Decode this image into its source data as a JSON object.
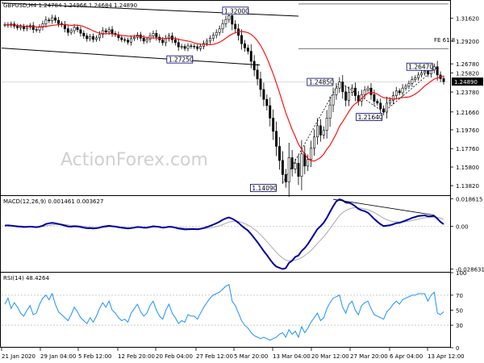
{
  "chart_data": [
    {
      "type": "candlestick",
      "header": "GBPUSD,H4  1.24784 1.24966 1.24684 1.24890",
      "price_axis_ticks": [
        "1.31620",
        "1.29200",
        "1.26780",
        "1.25820",
        "1.23780",
        "1.21660",
        "1.19760",
        "1.17760",
        "1.15800",
        "1.13820"
      ],
      "price_axis_values": [
        1.3162,
        1.292,
        1.2678,
        1.2582,
        1.2378,
        1.2166,
        1.1976,
        1.1776,
        1.158,
        1.1382
      ],
      "current_price_label": "1.24890",
      "ylim": [
        1.128,
        1.334
      ],
      "fib_label": "FE 61.8",
      "annotations": [
        {
          "label": "1.32000",
          "price": 1.32,
          "date": "5 Mar"
        },
        {
          "label": "1.27250",
          "price": 1.2725,
          "date": "27 Feb"
        },
        {
          "label": "1.24850",
          "price": 1.2485,
          "date": "26 Mar"
        },
        {
          "label": "1.26470",
          "price": 1.2647,
          "date": "13 Apr"
        },
        {
          "label": "1.21640",
          "price": 1.2164,
          "date": "6 Apr"
        },
        {
          "label": "1.14090",
          "price": 1.1409,
          "date": "20 Mar"
        }
      ],
      "close": [
        1.3095,
        1.3088,
        1.3102,
        1.3079,
        1.3061,
        1.3075,
        1.3052,
        1.3068,
        1.3085,
        1.3043,
        1.3038,
        1.3068,
        1.3102,
        1.3145,
        1.3136,
        1.3168,
        1.3142,
        1.3105,
        1.3095,
        1.3052,
        1.3012,
        1.3031,
        1.3066,
        1.3041,
        1.3004,
        1.2975,
        1.2945,
        1.2968,
        1.2938,
        1.2955,
        1.299,
        1.3031,
        1.3016,
        1.3042,
        1.3002,
        1.2988,
        1.2955,
        1.2935,
        1.293,
        1.2908,
        1.2946,
        1.296,
        1.2985,
        1.2951,
        1.292,
        1.294,
        1.2975,
        1.3002,
        1.2962,
        1.2932,
        1.2903,
        1.2946,
        1.2975,
        1.2935,
        1.2905,
        1.2858,
        1.2863,
        1.2842,
        1.2869,
        1.2865,
        1.286,
        1.284,
        1.2865,
        1.2895,
        1.292,
        1.295,
        1.2981,
        1.3012,
        1.305,
        1.3105,
        1.315,
        1.319,
        1.31,
        1.305,
        1.298,
        1.2892,
        1.2847,
        1.2812,
        1.2705,
        1.2612,
        1.2517,
        1.2405,
        1.23,
        1.2233,
        1.21,
        1.196,
        1.18,
        1.165,
        1.15,
        1.142,
        1.168,
        1.156,
        1.162,
        1.148,
        1.172,
        1.159,
        1.166,
        1.178,
        1.19,
        1.202,
        1.192,
        1.197,
        1.21,
        1.224,
        1.235,
        1.242,
        1.2485,
        1.238,
        1.229,
        1.2375,
        1.242,
        1.234,
        1.228,
        1.235,
        1.24,
        1.242,
        1.235,
        1.228,
        1.226,
        1.22,
        1.2164,
        1.226,
        1.229,
        1.234,
        1.239,
        1.237,
        1.242,
        1.244,
        1.247,
        1.251,
        1.253,
        1.256,
        1.258,
        1.26,
        1.257,
        1.2612,
        1.2647,
        1.256,
        1.252,
        1.2489
      ],
      "series": [
        {
          "name": "",
          "note": "moving average, red"
        }
      ]
    },
    {
      "type": "line",
      "header": "MACD(12,26,9) 0.001461 0.003627",
      "axis_ticks": [
        "0.018615",
        "0.00",
        "-0.028631"
      ],
      "axis_values": [
        0.018615,
        0.0,
        -0.028631
      ],
      "ylim": [
        -0.0305,
        0.0204
      ],
      "series": [
        {
          "name": "",
          "values": [
            0.0006,
            0.0007,
            0.0005,
            0.0002,
            0.0,
            -0.0002,
            -0.0004,
            -0.0003,
            -0.0001,
            -0.0003,
            -0.0005,
            -0.0002,
            0.0005,
            0.0016,
            0.0021,
            0.0024,
            0.0021,
            0.0016,
            0.0012,
            0.0006,
            0.0,
            -0.0002,
            0.0001,
            0.0,
            -0.0004,
            -0.0008,
            -0.0012,
            -0.0012,
            -0.0014,
            -0.0012,
            -0.0008,
            -0.0002,
            0.0001,
            0.0004,
            0.0001,
            -0.0001,
            -0.0005,
            -0.0009,
            -0.0011,
            -0.0014,
            -0.0011,
            -0.0008,
            -0.0004,
            -0.0005,
            -0.0008,
            -0.0008,
            -0.0004,
            0.0001,
            -0.0001,
            -0.0004,
            -0.0008,
            -0.0006,
            -0.0002,
            -0.0004,
            -0.0008,
            -0.0014,
            -0.0017,
            -0.002,
            -0.0019,
            -0.0018,
            -0.0018,
            -0.0019,
            -0.0016,
            -0.0011,
            -0.0004,
            0.0003,
            0.0012,
            0.0021,
            0.0031,
            0.0044,
            0.0054,
            0.006,
            0.0052,
            0.004,
            0.0024,
            0.0005,
            -0.0012,
            -0.0028,
            -0.0052,
            -0.0078,
            -0.0105,
            -0.0135,
            -0.0165,
            -0.0192,
            -0.0222,
            -0.025,
            -0.027,
            -0.0278,
            -0.0286,
            -0.028,
            -0.0245,
            -0.023,
            -0.0205,
            -0.0195,
            -0.0165,
            -0.0145,
            -0.0118,
            -0.0085,
            -0.0052,
            -0.0018,
            0.0002,
            0.0025,
            0.0058,
            0.0098,
            0.0135,
            0.0168,
            0.0182,
            0.0175,
            0.016,
            0.0158,
            0.015,
            0.0135,
            0.0118,
            0.0108,
            0.0102,
            0.0092,
            0.0072,
            0.005,
            0.0032,
            0.0015,
            0.0002,
            0.0005,
            0.0008,
            0.0014,
            0.0022,
            0.0024,
            0.0032,
            0.004,
            0.0048,
            0.0057,
            0.0063,
            0.007,
            0.0072,
            0.0074,
            0.0068,
            0.0068,
            0.007,
            0.0052,
            0.003,
            0.0015
          ]
        },
        {
          "name": "",
          "values": [
            0.0006,
            0.0006,
            0.0006,
            0.0005,
            0.0004,
            0.0003,
            0.0001,
            0.0,
            0.0,
            -0.0001,
            -0.0002,
            -0.0002,
            -0.0001,
            0.0003,
            0.0007,
            0.001,
            0.0012,
            0.0013,
            0.0013,
            0.0012,
            0.001,
            0.0007,
            0.0006,
            0.0005,
            0.0003,
            0.0001,
            -0.0002,
            -0.0004,
            -0.0006,
            -0.0007,
            -0.0008,
            -0.0007,
            -0.0005,
            -0.0003,
            -0.0002,
            -0.0002,
            -0.0003,
            -0.0004,
            -0.0006,
            -0.0007,
            -0.0008,
            -0.0008,
            -0.0007,
            -0.0007,
            -0.0007,
            -0.0007,
            -0.0007,
            -0.0005,
            -0.0004,
            -0.0004,
            -0.0005,
            -0.0005,
            -0.0005,
            -0.0005,
            -0.0005,
            -0.0007,
            -0.0009,
            -0.0011,
            -0.0013,
            -0.0014,
            -0.0015,
            -0.0016,
            -0.0016,
            -0.0015,
            -0.0013,
            -0.001,
            -0.0006,
            -0.0001,
            0.0005,
            0.0012,
            0.0021,
            0.0029,
            0.0033,
            0.0035,
            0.0033,
            0.0027,
            0.0019,
            0.0009,
            -0.0004,
            -0.0019,
            -0.0036,
            -0.0056,
            -0.0078,
            -0.0101,
            -0.0125,
            -0.015,
            -0.0174,
            -0.0195,
            -0.0213,
            -0.0227,
            -0.0231,
            -0.0231,
            -0.0226,
            -0.022,
            -0.0209,
            -0.0196,
            -0.018,
            -0.0161,
            -0.0139,
            -0.0115,
            -0.0092,
            -0.0069,
            -0.0043,
            -0.0015,
            0.0015,
            0.0045,
            0.0073,
            0.0093,
            0.0107,
            0.0117,
            0.0123,
            0.0126,
            0.0124,
            0.0121,
            0.0117,
            0.0112,
            0.0104,
            0.0093,
            0.0081,
            0.0068,
            0.0055,
            0.0045,
            0.0038,
            0.0033,
            0.0031,
            0.003,
            0.003,
            0.0032,
            0.0035,
            0.004,
            0.0044,
            0.0049,
            0.0054,
            0.0058,
            0.006,
            0.0062,
            0.0063,
            0.0061,
            0.0055,
            0.0047
          ]
        }
      ]
    },
    {
      "type": "line",
      "header": "RSI(14) 48.4264",
      "axis_ticks": [
        "100",
        "70",
        "50",
        "30",
        "0"
      ],
      "axis_values": [
        100,
        70,
        50,
        30,
        0
      ],
      "ylim": [
        0,
        100
      ],
      "series": [
        {
          "name": "",
          "values": [
            58,
            66,
            52,
            60,
            54,
            46,
            42,
            50,
            56,
            44,
            46,
            58,
            66,
            70,
            64,
            72,
            58,
            48,
            44,
            40,
            36,
            44,
            54,
            48,
            40,
            36,
            32,
            40,
            34,
            42,
            52,
            60,
            54,
            62,
            50,
            46,
            40,
            36,
            38,
            34,
            46,
            52,
            58,
            48,
            42,
            46,
            56,
            62,
            50,
            42,
            38,
            50,
            58,
            46,
            40,
            32,
            36,
            34,
            44,
            42,
            42,
            38,
            46,
            54,
            60,
            66,
            70,
            72,
            74,
            78,
            82,
            84,
            62,
            56,
            46,
            36,
            30,
            26,
            20,
            16,
            14,
            12,
            14,
            12,
            10,
            12,
            14,
            18,
            20,
            14,
            24,
            18,
            22,
            14,
            28,
            20,
            26,
            34,
            40,
            46,
            36,
            40,
            52,
            60,
            66,
            68,
            70,
            54,
            46,
            58,
            62,
            50,
            44,
            56,
            60,
            62,
            52,
            44,
            42,
            40,
            38,
            48,
            52,
            58,
            62,
            58,
            64,
            66,
            68,
            70,
            70,
            72,
            72,
            72,
            62,
            70,
            74,
            46,
            44,
            48
          ]
        }
      ]
    }
  ],
  "x_axis_ticks": [
    "21 Jan 2020",
    "29 Jan 04:00",
    "5 Feb 12:00",
    "12 Feb 20:00",
    "20 Feb 04:00",
    "27 Feb 12:00",
    "5 Mar 20:00",
    "13 Mar 04:00",
    "20 Mar 12:00",
    "27 Mar 20:00",
    "6 Apr 04:00",
    "13 Apr 12:00"
  ],
  "watermark": "ActionForex.com",
  "colors": {
    "bull": "#000000",
    "bear": "#000000",
    "ma": "#ff0000",
    "macd_main": "#0000a0",
    "macd_signal": "#aaaaaa",
    "rsi": "#1e90ff",
    "label_border": "#000080",
    "grid": "#000000",
    "bg": "#ffffff"
  }
}
